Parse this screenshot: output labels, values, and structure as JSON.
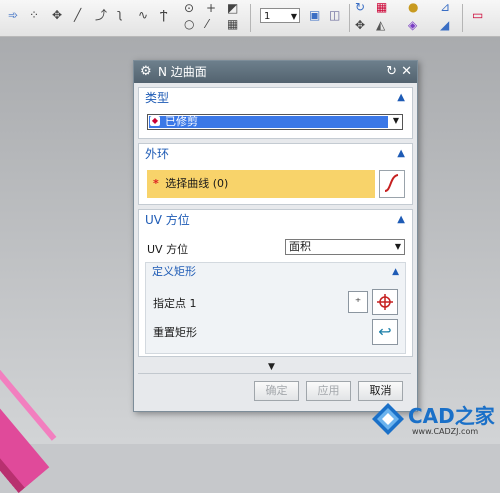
{
  "toolbar": {
    "zoom_value": "1"
  },
  "dialog": {
    "title": "N 边曲面",
    "type_group": {
      "header": "类型",
      "selected": "已修剪"
    },
    "outer_loop_group": {
      "header": "外环",
      "select_curve_label": "选择曲线 (0)"
    },
    "uv_group": {
      "header": "UV 方位",
      "field_label": "UV 方位",
      "field_value": "面积",
      "define_rect": {
        "header": "定义矩形",
        "specify_point_label": "指定点 1",
        "reset_rect_label": "重置矩形"
      }
    },
    "buttons": {
      "ok": "确定",
      "apply": "应用",
      "cancel": "取消"
    }
  },
  "watermark": {
    "brand": "CAD之家",
    "url": "www.CADZJ.com"
  }
}
